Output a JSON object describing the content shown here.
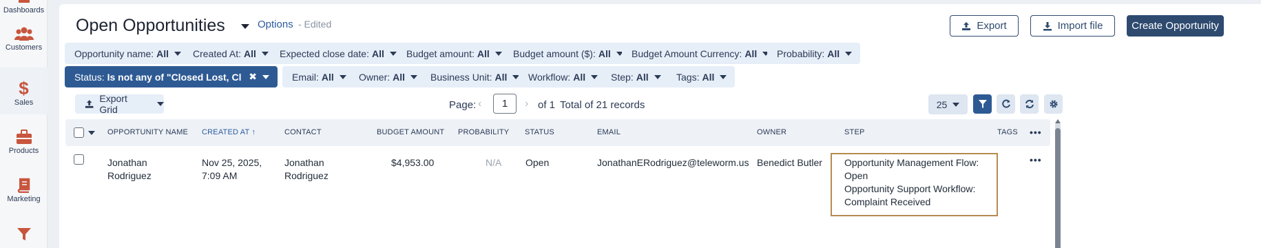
{
  "sidebar": {
    "items": [
      {
        "label": "Dashboards",
        "icon": "dashboard-icon"
      },
      {
        "label": "Customers",
        "icon": "users-icon"
      },
      {
        "label": "Sales",
        "icon": "dollar-icon"
      },
      {
        "label": "Products",
        "icon": "briefcase-icon"
      },
      {
        "label": "Marketing",
        "icon": "book-icon"
      },
      {
        "label": "",
        "icon": "funnel-icon"
      }
    ]
  },
  "header": {
    "title": "Open Opportunities",
    "options_link": "Options",
    "edited_text": "- Edited",
    "export_label": "Export",
    "import_label": "Import file",
    "create_label": "Create Opportunity"
  },
  "filters": {
    "row1": [
      {
        "name": "Opportunity name:",
        "value": "All"
      },
      {
        "name": "Created At:",
        "value": "All"
      },
      {
        "name": "Expected close date:",
        "value": "All"
      },
      {
        "name": "Budget amount:",
        "value": "All"
      },
      {
        "name": "Budget amount ($):",
        "value": "All"
      },
      {
        "name": "Budget Amount Currency:",
        "value": "All"
      },
      {
        "name": "Probability:",
        "value": "All"
      }
    ],
    "status": {
      "name": "Status:",
      "value": "Is not any of \"Closed Lost, Closed ..."
    },
    "row2": [
      {
        "name": "Email:",
        "value": "All"
      },
      {
        "name": "Owner:",
        "value": "All"
      },
      {
        "name": "Business Unit:",
        "value": "All"
      },
      {
        "name": "Workflow:",
        "value": "All"
      },
      {
        "name": "Step:",
        "value": "All"
      },
      {
        "name": "Tags:",
        "value": "All"
      }
    ]
  },
  "toolbar": {
    "export_grid_label": "Export Grid",
    "page_label": "Page:",
    "page_value": "1",
    "of_label": "of 1",
    "total_label": "Total of 21 records",
    "per_page": "25"
  },
  "table": {
    "columns": [
      "OPPORTUNITY NAME",
      "CREATED AT",
      "CONTACT",
      "BUDGET AMOUNT",
      "PROBABILITY",
      "STATUS",
      "EMAIL",
      "OWNER",
      "STEP",
      "TAGS"
    ],
    "rows": [
      {
        "name_line1": "Jonathan",
        "name_line2": "Rodriguez",
        "created_line1": "Nov 25, 2025,",
        "created_line2": "7:09 AM",
        "contact_line1": "Jonathan",
        "contact_line2": "Rodriguez",
        "budget": "$4,953.00",
        "probability": "N/A",
        "status": "Open",
        "email": "JonathanERodriguez@teleworm.us",
        "owner": "Benedict Butler",
        "step_line1": "Opportunity Management Flow:",
        "step_line2": "Open",
        "step_line3": "Opportunity Support Workflow:",
        "step_line4": "Complaint Received"
      }
    ]
  },
  "colors": {
    "primary": "#2e4a6f",
    "accent_link": "#2c5aa0",
    "chip_bg": "#e6eef8",
    "status_chip_bg": "#2e5a94",
    "highlight_border": "#b58a4f"
  }
}
